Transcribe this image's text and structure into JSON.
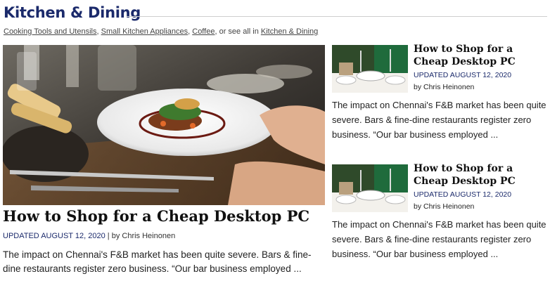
{
  "section": {
    "title": "Kitchen & Dining",
    "subnav": {
      "links": [
        "Cooking Tools and Utensils",
        "Small Kitchen Appliances",
        "Coffee"
      ],
      "see_all_prefix": ", or see all in ",
      "see_all_link": "Kitchen & Dining"
    }
  },
  "main_article": {
    "title": "How to Shop for a Cheap Desktop PC",
    "updated": "UPDATED AUGUST 12, 2020",
    "separator": " | ",
    "byline": "by Chris Heinonen",
    "excerpt": "The impact on Chennai's F&B market has been quite severe. Bars & fine-dine restaurants register zero business. “Our bar business employed ..."
  },
  "side_articles": [
    {
      "title": "How to Shop for a Cheap Desktop PC",
      "updated": "UPDATED AUGUST 12, 2020",
      "byline": "by Chris Heinonen",
      "excerpt": "The impact on Chennai's F&B market has been quite severe. Bars & fine-dine restaurants register zero business. “Our bar business employed ..."
    },
    {
      "title": "How to Shop for a Cheap Desktop PC",
      "updated": "UPDATED AUGUST 12, 2020",
      "byline": "by Chris Heinonen",
      "excerpt": "The impact on Chennai's F&B market has been quite severe. Bars & fine-dine restaurants register zero business. “Our bar business employed ..."
    }
  ],
  "colors": {
    "accent": "#1b2a6b",
    "rule": "#cfcfcf"
  }
}
